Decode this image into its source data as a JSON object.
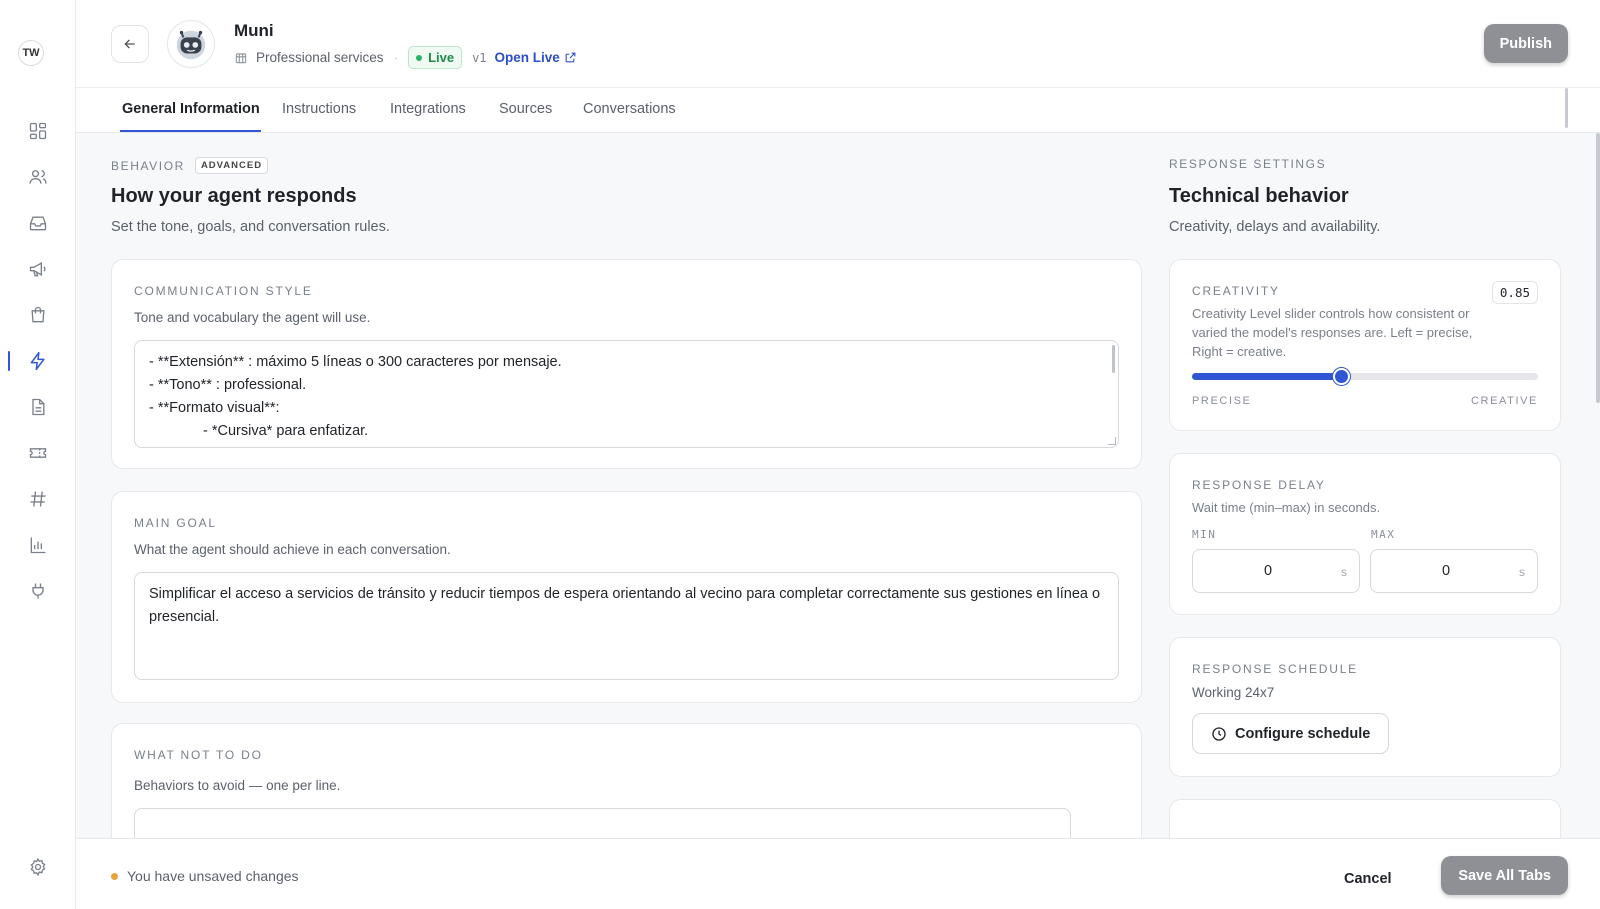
{
  "rail": {
    "avatar_initials": "TW",
    "icons": [
      "dashboard-icon",
      "users-icon",
      "inbox-icon",
      "megaphone-icon",
      "shopping-bag-icon",
      "lightning-icon",
      "document-icon",
      "ticket-icon",
      "hash-icon",
      "bar-chart-icon",
      "plug-icon"
    ],
    "active_icon": "lightning-icon",
    "bottom_icon": "gear-icon"
  },
  "header": {
    "agent_name": "Muni",
    "category": "Professional services",
    "status": "Live",
    "version": "v1",
    "open_live": "Open Live",
    "publish": "Publish"
  },
  "tabs": [
    {
      "label": "General Information",
      "active": true
    },
    {
      "label": "Instructions",
      "active": false
    },
    {
      "label": "Integrations",
      "active": false
    },
    {
      "label": "Sources",
      "active": false
    },
    {
      "label": "Conversations",
      "active": false
    }
  ],
  "behavior": {
    "kicker": "BEHAVIOR",
    "badge": "ADVANCED",
    "title": "How your agent responds",
    "subtitle": "Set the tone, goals, and conversation rules.",
    "communication_style": {
      "label": "COMMUNICATION STYLE",
      "help": "Tone and vocabulary the agent will use.",
      "lines": [
        "- **Extensión** : máximo 5 líneas o 300 caracteres por mensaje.",
        "- **Tono** : professional.",
        "- **Formato visual**:",
        "- *Cursiva* para enfatizar."
      ]
    },
    "main_goal": {
      "label": "MAIN GOAL",
      "help": "What the agent should achieve in each conversation.",
      "value": "Simplificar el acceso a servicios de tránsito y reducir tiempos de espera orientando al vecino para completar correctamente sus gestiones en línea o presencial."
    },
    "what_not_to_do": {
      "label": "WHAT NOT TO DO",
      "help": "Behaviors to avoid — one per line."
    }
  },
  "response_settings": {
    "kicker": "RESPONSE SETTINGS",
    "title": "Technical behavior",
    "subtitle": "Creativity, delays and availability.",
    "creativity": {
      "label": "CREATIVITY",
      "value": "0.85",
      "level": 0.43,
      "description": "Creativity Level slider controls how consistent or varied the model's responses are. Left = precise, Right = creative.",
      "left_label": "PRECISE",
      "right_label": "CREATIVE"
    },
    "response_delay": {
      "label": "RESPONSE DELAY",
      "help": "Wait time (min–max) in seconds.",
      "min_label": "MIN",
      "max_label": "MAX",
      "min_value": "0",
      "max_value": "0",
      "unit": "s"
    },
    "response_schedule": {
      "label": "RESPONSE SCHEDULE",
      "value": "Working 24x7",
      "button": "Configure schedule"
    }
  },
  "footer": {
    "unsaved": "You have unsaved changes",
    "cancel": "Cancel",
    "save_all": "Save All Tabs"
  },
  "colors": {
    "accent": "#3156d4",
    "live_green": "#1f8a4c",
    "unsaved_dot": "#e8a33b",
    "disabled_button": "#8e9096"
  }
}
